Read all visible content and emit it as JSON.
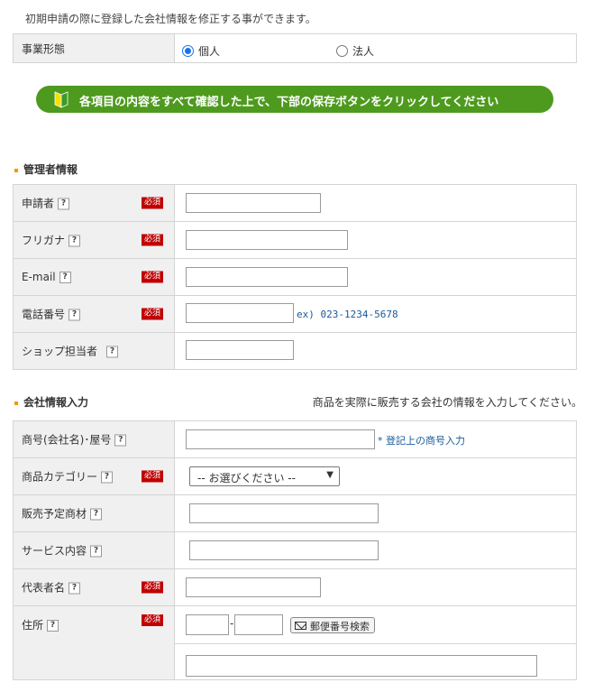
{
  "intro": "初期申請の際に登録した会社情報を修正する事ができます。",
  "business_type": {
    "label": "事業形態",
    "options": [
      "個人",
      "法人"
    ],
    "selected": "個人"
  },
  "banner_text": "各項目の内容をすべて確認した上で、下部の保存ボタンをクリックしてください",
  "admin_section": {
    "title": "管理者情報",
    "rows": [
      {
        "label": "申請者",
        "help": "?",
        "required": "必須"
      },
      {
        "label": "フリガナ",
        "help": "?",
        "required": "必須"
      },
      {
        "label": "E-mail",
        "help": "?",
        "required": "必須"
      },
      {
        "label": "電話番号",
        "help": "?",
        "required": "必須",
        "hint": "ex) 023-1234-5678"
      },
      {
        "label": "ショップ担当者",
        "help": "?"
      }
    ]
  },
  "company_section": {
    "title": "会社情報入力",
    "note": "商品を実際に販売する会社の情報を入力してください。",
    "rows": [
      {
        "label": "商号(会社名)･屋号",
        "help": "?",
        "hint": "* 登記上の商号入力"
      },
      {
        "label": "商品カテゴリー",
        "help": "?",
        "required": "必須",
        "select_value": "-- お選びください --"
      },
      {
        "label": "販売予定商材",
        "help": "?"
      },
      {
        "label": "サービス内容",
        "help": "?"
      },
      {
        "label": "代表者名",
        "help": "?",
        "required": "必須"
      },
      {
        "label": "住所",
        "help": "?",
        "required": "必須",
        "zip_dash": "-",
        "zip_button": "郵便番号検索"
      }
    ]
  },
  "colors": {
    "banner": "#4e9a1e",
    "required_badge": "#c00000",
    "label_bg": "#f0f0f0",
    "section_marker": "#f39800",
    "hint_text": "#1a5a9a"
  }
}
